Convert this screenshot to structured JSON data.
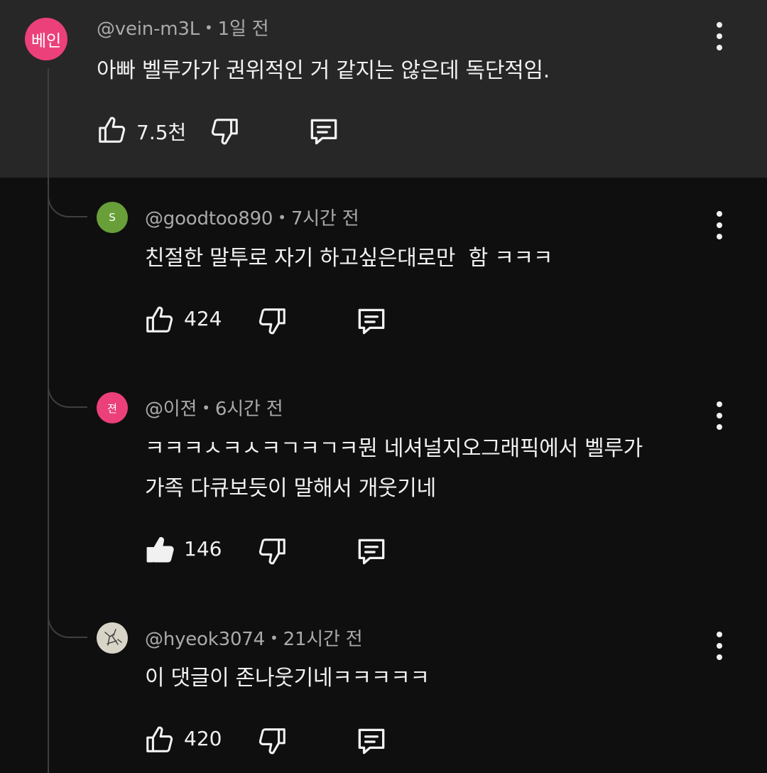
{
  "comments": [
    {
      "avatar_text": "베인",
      "avatar_color": "#ec407a",
      "handle": "@vein-m3L",
      "time": "1일 전",
      "text": "아빠 벨루가가 권위적인 거 같지는 않은데 독단적임.",
      "likes": "7.5천"
    },
    {
      "avatar_text": "S",
      "avatar_color": "#689f38",
      "handle": "@goodtoo890",
      "time": "7시간 전",
      "text": "친절한 말투로 자기 하고싶은대로만  함 ㅋㅋㅋ",
      "likes": "424"
    },
    {
      "avatar_text": "젼",
      "avatar_color": "#ec407a",
      "handle": "@이젼",
      "time": "6시간 전",
      "text_lines": [
        "ㅋㅋㅋㅅㅋㅅㅋㄱㅋㄱㅋ뭔 네셔널지오그래픽에서 벨루가",
        "가족 다큐보듯이 말해서 개웃기네"
      ],
      "likes": "146",
      "liked": true
    },
    {
      "avatar_icon": "sketch-avatar-icon",
      "avatar_color": "#d8d4c8",
      "handle": "@hyeok3074",
      "time": "21시간 전",
      "text": "이 댓글이 존나웃기네ㅋㅋㅋㅋㅋ",
      "likes": "420"
    }
  ],
  "separator": "•",
  "icons": {
    "like": "thumbs-up-icon",
    "dislike": "thumbs-down-icon",
    "reply": "reply-icon",
    "more": "more-vertical-icon"
  }
}
